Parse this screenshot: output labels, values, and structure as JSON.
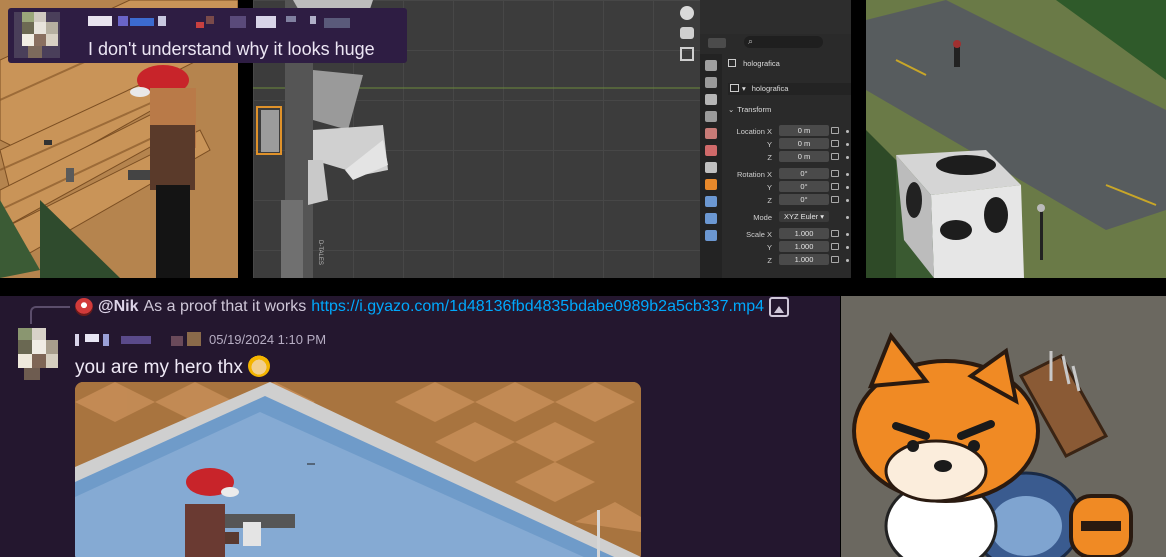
{
  "caption": {
    "text": "I don't understand why it looks huge"
  },
  "blender": {
    "object_name": "holografica",
    "data_name": "holografica",
    "transform_header": "Transform",
    "location_label": "Location X",
    "y_label": "Y",
    "z_label": "Z",
    "rotation_label": "Rotation X",
    "mode_label": "Mode",
    "scale_label": "Scale X",
    "location": [
      "0 m",
      "0 m",
      "0 m"
    ],
    "rotation": [
      "0°",
      "0°",
      "0°"
    ],
    "mode": "XYZ Euler",
    "scale": [
      "1.000",
      "1.000",
      "1.000"
    ],
    "gun_label": "D-TALES"
  },
  "reply": {
    "username": "@Nik",
    "text": "As a proof that it works",
    "link": "https://i.gyazo.com/1d48136fbd4835bdabe0989b2a5cb337.mp4"
  },
  "message": {
    "timestamp": "05/19/2024 1:10 PM",
    "text": "you are my hero thx"
  },
  "colors": {
    "chat_bg": "#24172f",
    "link": "#00a8fc",
    "caption_bg": "#2e1d43"
  },
  "icons": [
    "hand-icon",
    "camera-icon",
    "grid-icon",
    "image-icon",
    "emoji-icon"
  ]
}
